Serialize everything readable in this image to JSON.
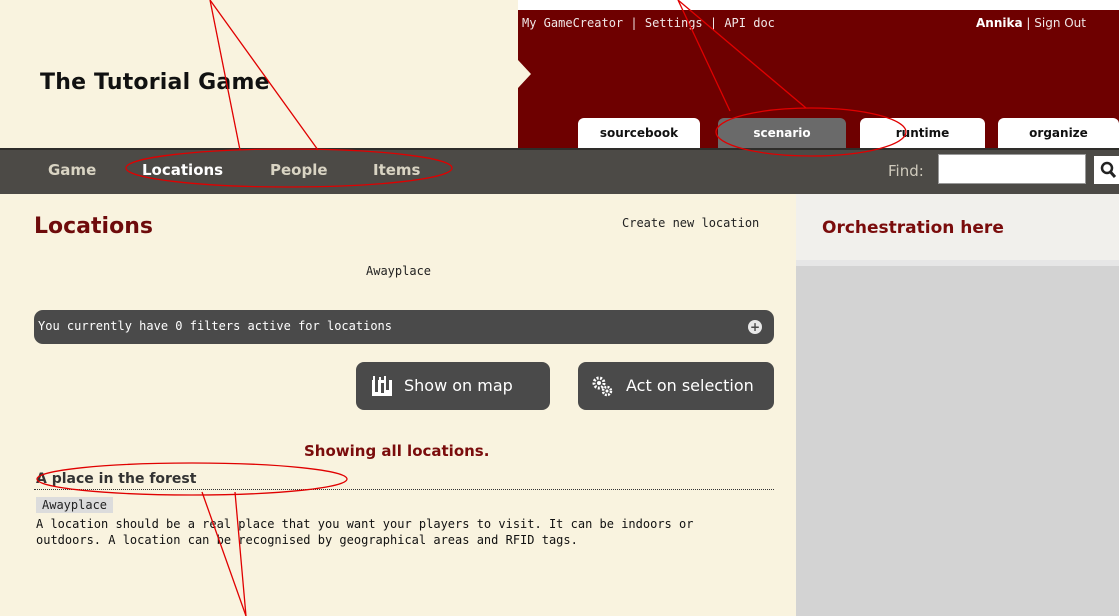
{
  "header": {
    "game_title": "The Tutorial Game",
    "top_links": [
      "My GameCreator",
      "Settings",
      "API doc"
    ],
    "separator": " | ",
    "user_name": "Annika",
    "sign_out": "Sign Out",
    "tabs": [
      "sourcebook",
      "scenario",
      "runtime",
      "organize"
    ],
    "active_tab": "scenario"
  },
  "nav": {
    "items": [
      "Game",
      "Locations",
      "People",
      "Items"
    ],
    "active": "Locations",
    "find_label": "Find:",
    "find_value": ""
  },
  "main": {
    "title": "Locations",
    "create_link": "Create new location",
    "tag_filter": "Awayplace",
    "filter_text": "You currently have 0 filters active for locations",
    "show_on_map": "Show on map",
    "act_on_selection": "Act on selection",
    "showing_text": "Showing all locations.",
    "locations": [
      {
        "name": "A place in the forest",
        "tag": "Awayplace",
        "description": "A location should be a real place that you want your players to visit. It can be indoors or outdoors. A location can be recognised by geographical areas and RFID tags."
      }
    ]
  },
  "sidebar": {
    "title": "Orchestration here"
  },
  "colors": {
    "header_maroon": "#6e0000",
    "cream": "#f9f3df",
    "nav_dark": "#4c4a46",
    "title_red": "#6e0b0b",
    "annotation_red": "#e00000"
  }
}
